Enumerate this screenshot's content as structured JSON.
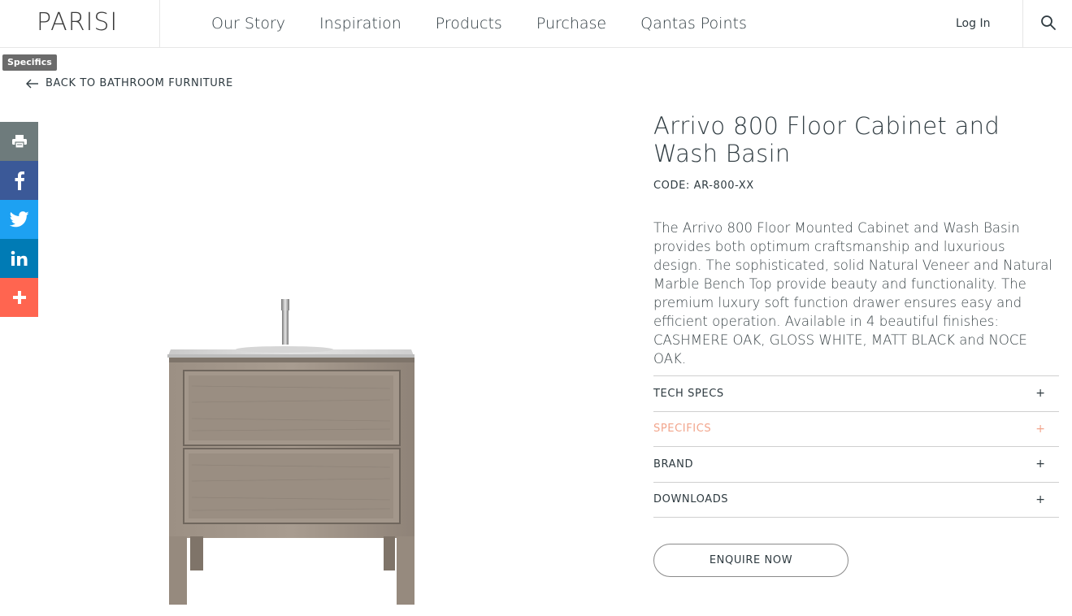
{
  "header": {
    "logo": "PARISI",
    "nav": [
      "Our Story",
      "Inspiration",
      "Products",
      "Purchase",
      "Qantas Points"
    ],
    "login": "Log In",
    "search_icon": "search-icon"
  },
  "tooltip": "Specifics",
  "back_link": "BACK TO BATHROOM FURNITURE",
  "share": {
    "icons": [
      "print-icon",
      "facebook-icon",
      "twitter-icon",
      "linkedin-icon",
      "plus-icon"
    ],
    "colors": {
      "print": "#6e7b7c",
      "facebook": "#3b5998",
      "twitter": "#1da1f2",
      "linkedin": "#007bb5",
      "more": "#ff6550"
    }
  },
  "product": {
    "title": "Arrivo 800 Floor Cabinet and Wash Basin",
    "code": "CODE: AR-800-XX",
    "description": "The Arrivo 800 Floor Mounted Cabinet and Wash Basin provides both optimum craftsmanship and luxurious design. The sophisticated, solid Natural Veneer and Natural Marble Bench Top provide beauty and functionality. The premium luxury soft function drawer ensures easy and efficient operation. Available in 4 beautiful finishes: CASHMERE OAK, GLOSS WHITE, MATT BLACK and NOCE OAK.",
    "accordion": [
      {
        "label": "TECH SPECS",
        "icon": "+"
      },
      {
        "label": "SPECIFICS",
        "icon": "+",
        "active": true
      },
      {
        "label": "BRAND",
        "icon": "+"
      },
      {
        "label": "DOWNLOADS",
        "icon": "+"
      }
    ],
    "enquire": "ENQUIRE NOW"
  },
  "colors": {
    "accent": "#f2a58c",
    "text": "#2e3a40",
    "border": "#cfcfcf"
  }
}
